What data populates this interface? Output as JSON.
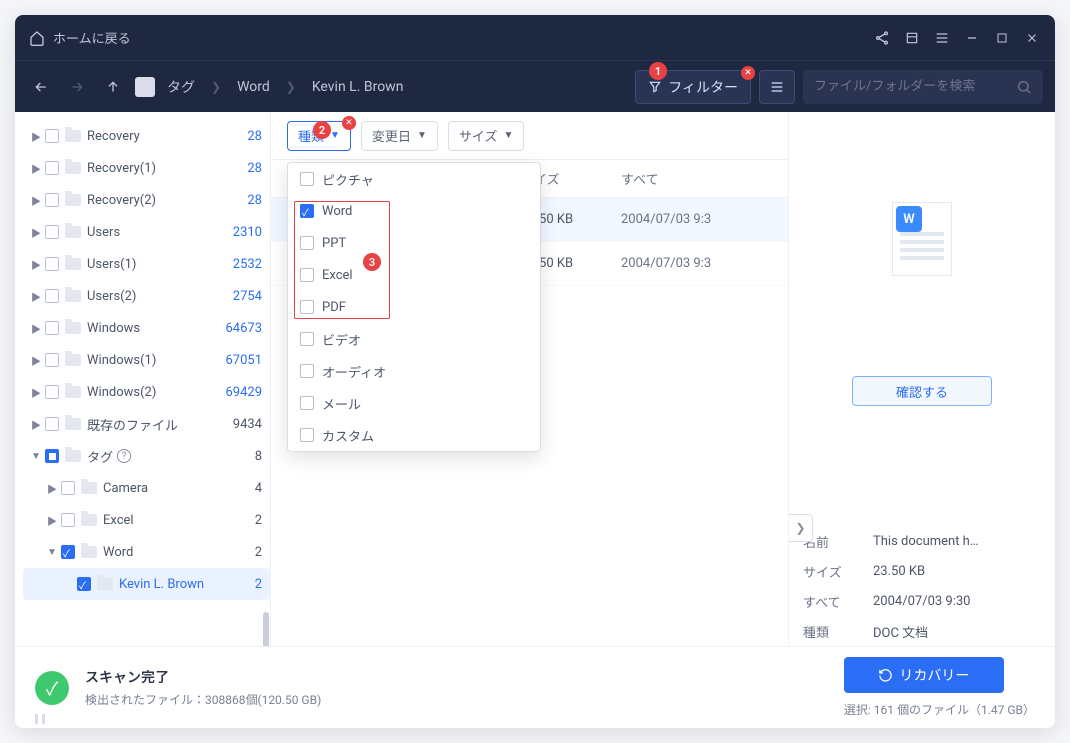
{
  "titlebar": {
    "home_label": "ホームに戻る"
  },
  "toolbar": {
    "crumb_tag": "タグ",
    "crumb_word": "Word",
    "crumb_owner": "Kevin L. Brown",
    "filter_label": "フィルター",
    "search_placeholder": "ファイル/フォルダーを検索"
  },
  "filters": {
    "type_label": "種類",
    "date_label": "変更日",
    "size_label": "サイズ"
  },
  "dropdown": {
    "options": [
      {
        "label": "ピクチャ",
        "checked": false
      },
      {
        "label": "Word",
        "checked": true
      },
      {
        "label": "PPT",
        "checked": false
      },
      {
        "label": "Excel",
        "checked": false
      },
      {
        "label": "PDF",
        "checked": false
      },
      {
        "label": "ビデオ",
        "checked": false
      },
      {
        "label": "オーディオ",
        "checked": false
      },
      {
        "label": "メール",
        "checked": false
      },
      {
        "label": "カスタム",
        "checked": false
      }
    ]
  },
  "sidebar": {
    "items": [
      {
        "label": "Recovery",
        "count": "28",
        "caret": "▶",
        "blue": true
      },
      {
        "label": "Recovery(1)",
        "count": "28",
        "caret": "▶",
        "blue": true
      },
      {
        "label": "Recovery(2)",
        "count": "28",
        "caret": "▶",
        "blue": true
      },
      {
        "label": "Users",
        "count": "2310",
        "caret": "▶",
        "blue": true
      },
      {
        "label": "Users(1)",
        "count": "2532",
        "caret": "▶",
        "blue": true
      },
      {
        "label": "Users(2)",
        "count": "2754",
        "caret": "▶",
        "blue": true
      },
      {
        "label": "Windows",
        "count": "64673",
        "caret": "▶",
        "blue": true
      },
      {
        "label": "Windows(1)",
        "count": "67051",
        "caret": "▶",
        "blue": true
      },
      {
        "label": "Windows(2)",
        "count": "69429",
        "caret": "▶",
        "blue": true
      },
      {
        "label": "既存のファイル",
        "count": "9434",
        "caret": "▶"
      },
      {
        "label": "タグ",
        "count": "8",
        "caret": "▼",
        "partial": true,
        "help": true
      },
      {
        "label": "Camera",
        "count": "4",
        "caret": "▶",
        "indent": 1
      },
      {
        "label": "Excel",
        "count": "2",
        "caret": "▶",
        "indent": 1
      },
      {
        "label": "Word",
        "count": "2",
        "caret": "▼",
        "indent": 1,
        "checked": true
      },
      {
        "label": "Kevin L. Brown",
        "count": "2",
        "caret": "",
        "indent": 2,
        "checked": true,
        "active": true
      }
    ]
  },
  "table": {
    "head_size": "サイズ",
    "head_all": "すべて",
    "rows": [
      {
        "size": "23.50 KB",
        "date": "2004/07/03 9:3",
        "sel": true
      },
      {
        "size": "23.50 KB",
        "date": "2004/07/03 9:3",
        "sel": false
      }
    ]
  },
  "preview": {
    "thumb_badge": "W",
    "confirm_label": "確認する",
    "name_k": "名前",
    "name_v": "This document h…",
    "size_k": "サイズ",
    "size_v": "23.50 KB",
    "all_k": "すべて",
    "all_v": "2004/07/03 9:30",
    "type_k": "種類",
    "type_v": "DOC 文档"
  },
  "footer": {
    "scan_done": "スキャン完了",
    "detected": "検出されたファイル：308868個(120.50 GB)",
    "recover_label": "リカバリー",
    "selected": "選択: 161 個のファイル（1.47 GB）"
  },
  "annot": {
    "n1": "1",
    "n2": "2",
    "n3": "3"
  }
}
